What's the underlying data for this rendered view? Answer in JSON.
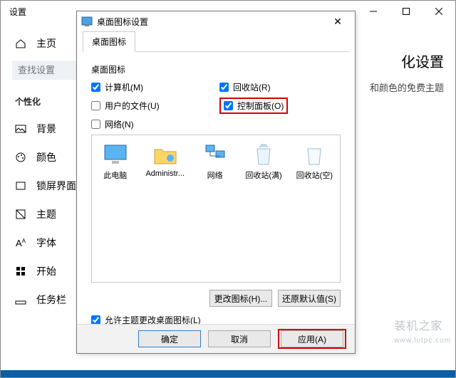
{
  "settings": {
    "title": "设置",
    "search_placeholder": "查找设置",
    "home": "主页",
    "section": "个性化",
    "nav": {
      "background": "背景",
      "colors": "颜色",
      "lockscreen": "锁屏界面",
      "themes": "主题",
      "fonts": "字体",
      "start": "开始",
      "taskbar": "任务栏"
    },
    "peek_heading": "化设置",
    "peek_text": "和颜色的免费主题"
  },
  "dialog": {
    "title": "桌面图标设置",
    "tab": "桌面图标",
    "group": "桌面图标",
    "checks": {
      "computer": "计算机(M)",
      "recycle": "回收站(R)",
      "userfiles": "用户的文件(U)",
      "control": "控制面板(O)",
      "network": "网络(N)"
    },
    "icons": {
      "thispc": "此电脑",
      "admin": "Administr...",
      "network": "网络",
      "recycle_full": "回收站(满)",
      "recycle_empty": "回收站(空)"
    },
    "change_icon": "更改图标(H)...",
    "restore_default": "还原默认值(S)",
    "allow_themes": "允许主题更改桌面图标(L)",
    "ok": "确定",
    "cancel": "取消",
    "apply": "应用(A)"
  },
  "watermark": "装机之家",
  "watermark_url": "www.lotpc.com"
}
